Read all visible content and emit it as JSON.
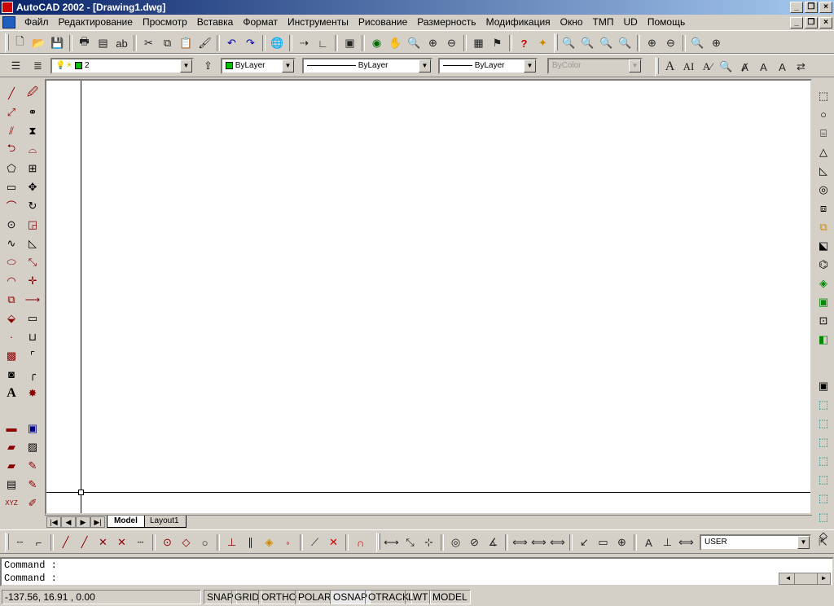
{
  "title": "AutoCAD 2002 - [Drawing1.dwg]",
  "menu": [
    "Файл",
    "Редактирование",
    "Просмотр",
    "Вставка",
    "Формат",
    "Инструменты",
    "Рисование",
    "Размерность",
    "Модификация",
    "Окно",
    "ТМП",
    "UD",
    "Помощь"
  ],
  "props": {
    "layer": "2",
    "color": "ByLayer",
    "linetype": "ByLayer",
    "lineweight": "ByLayer",
    "plotstyle": "ByColor"
  },
  "ucs_combo": "USER",
  "tabs": [
    "Model",
    "Layout1"
  ],
  "command_lines": [
    "Command :",
    "Command :"
  ],
  "coords": "-137.56, 16.91 , 0.00",
  "status_buttons": [
    "SNAP",
    "GRID",
    "ORTHO",
    "POLAR",
    "OSNAP",
    "OTRACK",
    "LWT",
    "MODEL"
  ],
  "colors": {
    "title_start": "#0a246a",
    "title_end": "#a6caf0",
    "layer_color": "#00c000"
  },
  "icons": {
    "standard": [
      "new",
      "open",
      "save",
      "print",
      "preview",
      "spell",
      "cut",
      "copy",
      "paste",
      "matchprop",
      "undo",
      "redo",
      "internet",
      "pick",
      "ucs",
      "pan",
      "zoom-window",
      "zoom-prev",
      "properties",
      "help"
    ],
    "draw": [
      "line",
      "xline",
      "mline",
      "pline",
      "polygon",
      "rectangle",
      "arc",
      "circle",
      "spline",
      "ellipse",
      "ellipse-arc",
      "insert",
      "block",
      "point",
      "hatch",
      "region",
      "text"
    ],
    "modify": [
      "erase",
      "copy-obj",
      "mirror",
      "offset",
      "array",
      "move",
      "rotate",
      "scale",
      "stretch",
      "lengthen",
      "trim",
      "extend",
      "break",
      "chamfer",
      "fillet",
      "explode"
    ]
  }
}
